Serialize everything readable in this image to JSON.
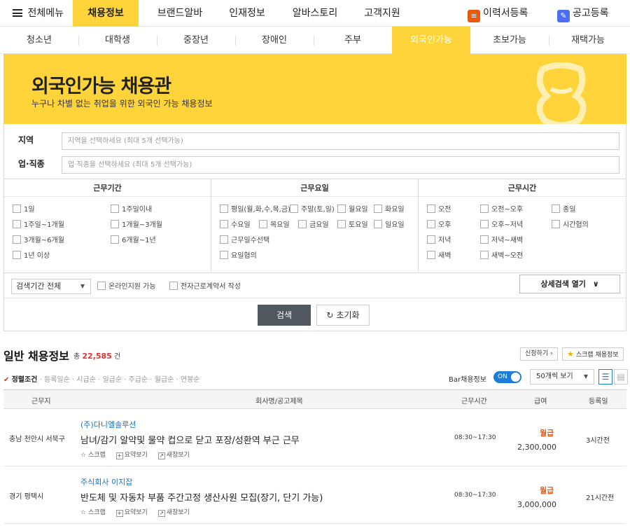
{
  "topnav": {
    "menu_all": "전체메뉴",
    "tabs": [
      "채용정보",
      "브랜드알바",
      "인재정보",
      "알바스토리",
      "고객지원"
    ],
    "resume_btn": "이력서등록",
    "post_btn": "공고등록"
  },
  "subnav": [
    "청소년",
    "대학생",
    "중장년",
    "장애인",
    "주부",
    "외국인가능",
    "초보가능",
    "재택가능"
  ],
  "banner": {
    "title": "외국인가능 채용관",
    "subtitle": "누구나 차별 없는 취업을 위한 외국인 가능 채용정보"
  },
  "search": {
    "region_label": "지역",
    "region_placeholder": "지역을 선택하세요 (최대 5개 선택가능)",
    "job_label": "업·직종",
    "job_placeholder": "업·직종을 선택하세요 (최대 5개 선택가능)",
    "period_head": "근무기간",
    "period_options": [
      "1일",
      "1주일이내",
      "1주일~1개월",
      "1개월~3개월",
      "3개월~6개월",
      "6개월~1년",
      "1년 이상"
    ],
    "days_head": "근무요일",
    "days_options": [
      "평일(월,화,수,목,금)",
      "주말(토,일)",
      "월요일",
      "화요일",
      "수요일",
      "목요일",
      "금요일",
      "토요일",
      "일요일",
      "근무일수선택",
      "요일협의"
    ],
    "time_head": "근무시간",
    "time_options": [
      "오전",
      "오전~오후",
      "종일",
      "오후",
      "오후~저녁",
      "시간협의",
      "저녁",
      "저녁~새벽",
      "새벽",
      "새벽~오전"
    ],
    "period_select": "검색기간 전체",
    "online_label": "온라인지원 가능",
    "contract_label": "전자근로계약서 작성",
    "detail_btn": "상세검색 열기",
    "search_btn": "검색",
    "reset_btn": "초기화"
  },
  "results": {
    "title": "일반 채용정보",
    "count_prefix": "총",
    "count": "22,585",
    "count_suffix": "건",
    "apply_btn": "신청하기",
    "scrap_btn": "스크랩 채용정보",
    "sort_selected": "정렬조건",
    "sorts": [
      "등록일순",
      "시급순",
      "일급순",
      "주급순",
      "월급순",
      "연봉순"
    ],
    "bar_label": "Bar채용정보",
    "toggle_label": "ON",
    "per_page": "50개씩 보기",
    "columns": [
      "근무지",
      "회사명/공고제목",
      "근무시간",
      "급여",
      "등록일"
    ],
    "rows": [
      {
        "location": "충남 천안시 서북구",
        "company": "(주)다니엘솔루션",
        "title": "남녀/감기 알약및 물약 컵으로 닫고 포장/성환역 부근 근무",
        "time": "08:30~17:30",
        "pay_type": "월급",
        "pay": "2,300,000",
        "registered": "3시간전"
      },
      {
        "location": "경기 평택시",
        "company": "주식회사 이지잡",
        "title": "반도체 및 자동차 부품 주간고정 생산사원 모집(장기, 단기 가능)",
        "time": "08:30~17:30",
        "pay_type": "월급",
        "pay": "3,000,000",
        "registered": "21시간전"
      }
    ],
    "row_actions": [
      "스크랩",
      "요약보기",
      "새창보기"
    ]
  },
  "colors": {
    "brand_yellow": "#ffd43b",
    "link_blue": "#1971c2",
    "pay_orange": "#e8590c",
    "count_red": "#e03131"
  }
}
